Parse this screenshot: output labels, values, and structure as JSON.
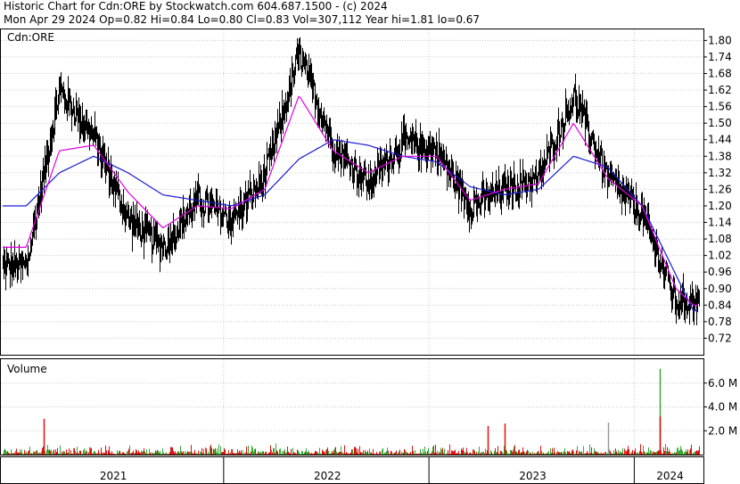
{
  "header": {
    "line1": "Historic Chart for Cdn:ORE by Stockwatch.com 604.687.1500 - (c) 2024",
    "line2": "Mon Apr 29 2024  Op=0.82  Hi=0.84  Lo=0.80  Cl=0.83  Vol=307,112  Year hi=1.81  lo=0.67"
  },
  "colors": {
    "price": "#000000",
    "ma_short": "#e000e0",
    "ma_long": "#1a1ad6",
    "volume_up": "#33aa33",
    "volume_down": "#dd1111",
    "volume_other": "#999999",
    "grid": "#c8c8c8",
    "frame": "#000000"
  },
  "chart_data": [
    {
      "type": "line",
      "title": "Cdn:ORE",
      "x": [
        "2021-01",
        "2021-03",
        "2021-05",
        "2021-07",
        "2021-09",
        "2021-11",
        "2022-01",
        "2022-03",
        "2022-05",
        "2022-07",
        "2022-09",
        "2022-11",
        "2023-01",
        "2023-03",
        "2023-05",
        "2023-07",
        "2023-09",
        "2023-11",
        "2024-01",
        "2024-03",
        "2024-04"
      ],
      "series": [
        {
          "role": "price",
          "values": [
            0.98,
            1.62,
            1.45,
            1.15,
            1.05,
            1.22,
            1.15,
            1.3,
            1.75,
            1.42,
            1.28,
            1.43,
            1.4,
            1.2,
            1.26,
            1.3,
            1.6,
            1.3,
            1.17,
            0.85,
            0.86
          ]
        },
        {
          "role": "ma_short",
          "values": [
            1.05,
            1.4,
            1.42,
            1.25,
            1.12,
            1.2,
            1.19,
            1.26,
            1.6,
            1.4,
            1.32,
            1.38,
            1.38,
            1.22,
            1.26,
            1.28,
            1.5,
            1.3,
            1.2,
            0.9,
            0.84
          ]
        },
        {
          "role": "ma_long",
          "values": [
            1.2,
            1.32,
            1.38,
            1.32,
            1.24,
            1.22,
            1.2,
            1.24,
            1.37,
            1.44,
            1.42,
            1.38,
            1.36,
            1.27,
            1.24,
            1.26,
            1.38,
            1.34,
            1.2,
            0.95,
            0.82
          ]
        }
      ],
      "ylim": [
        0.66,
        1.84
      ],
      "yticks": [
        "1.80",
        "1.74",
        "1.68",
        "1.62",
        "1.56",
        "1.50",
        "1.44",
        "1.38",
        "1.32",
        "1.26",
        "1.20",
        "1.14",
        "1.08",
        "1.02",
        "0.96",
        "0.90",
        "0.84",
        "0.78",
        "0.72"
      ],
      "xticks": [
        "2021",
        "2022",
        "2023",
        "2024"
      ],
      "grid": true,
      "legend": "none"
    },
    {
      "type": "bar",
      "title": "Volume",
      "yticks": [
        "6.0 M",
        "4.0 M",
        "2.0 M"
      ],
      "ylim": [
        0,
        8.0
      ],
      "notable_values_millions": [
        {
          "date": "2021-02",
          "value": 3.0
        },
        {
          "date": "2023-11",
          "value": 2.7
        },
        {
          "date": "2024-02",
          "value": 7.2
        },
        {
          "date": "2024-02",
          "value": 3.2
        },
        {
          "date": "2023-04",
          "value": 2.4
        },
        {
          "date": "2023-05",
          "value": 2.6
        }
      ]
    }
  ]
}
